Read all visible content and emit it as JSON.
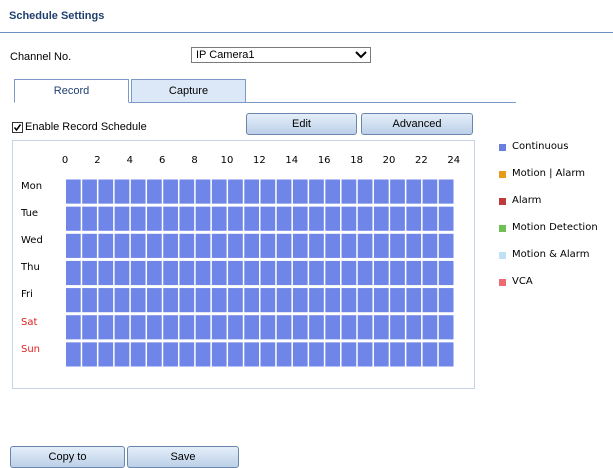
{
  "header": {
    "title": "Schedule Settings"
  },
  "channel": {
    "label": "Channel No.",
    "selected": "IP Camera1"
  },
  "tabs": [
    {
      "label": "Record",
      "active": true
    },
    {
      "label": "Capture",
      "active": false
    }
  ],
  "schedule": {
    "enable_label": "Enable Record Schedule",
    "enabled": true,
    "edit_label": "Edit",
    "advanced_label": "Advanced",
    "hours": [
      "0",
      "2",
      "4",
      "6",
      "8",
      "10",
      "12",
      "14",
      "16",
      "18",
      "20",
      "22",
      "24"
    ],
    "days": [
      {
        "label": "Mon",
        "weekend": false
      },
      {
        "label": "Tue",
        "weekend": false
      },
      {
        "label": "Wed",
        "weekend": false
      },
      {
        "label": "Thu",
        "weekend": false
      },
      {
        "label": "Fri",
        "weekend": false
      },
      {
        "label": "Sat",
        "weekend": true
      },
      {
        "label": "Sun",
        "weekend": true
      }
    ],
    "fill_color": "#6f86e8",
    "fill_type": "Continuous"
  },
  "legend": [
    {
      "label": "Continuous",
      "color": "#6b7fe0"
    },
    {
      "label": "Motion | Alarm",
      "color": "#e99a18"
    },
    {
      "label": "Alarm",
      "color": "#c0393b"
    },
    {
      "label": "Motion Detection",
      "color": "#6fbf54"
    },
    {
      "label": "Motion & Alarm",
      "color": "#bfe0f7"
    },
    {
      "label": "VCA",
      "color": "#ef6b73"
    }
  ],
  "footer": {
    "copy_label": "Copy to",
    "save_label": "Save"
  },
  "icons": {
    "dropdown": "chevron-down-icon",
    "check": "checkmark-icon"
  }
}
